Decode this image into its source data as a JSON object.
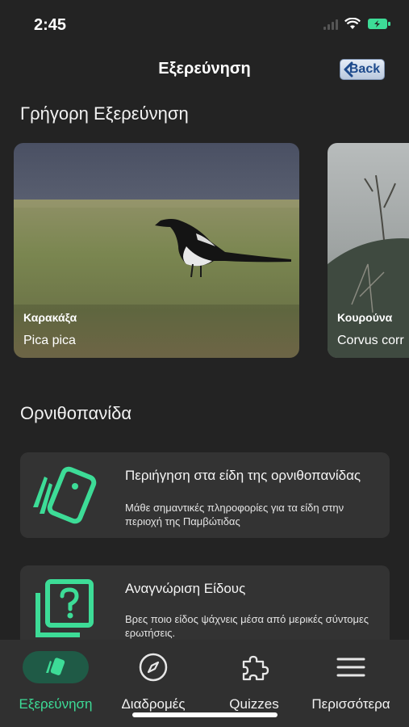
{
  "status": {
    "time": "2:45"
  },
  "nav": {
    "title": "Εξερεύνηση",
    "back_label": "Back"
  },
  "quick": {
    "title": "Γρήγορη Εξερεύνηση",
    "cards": [
      {
        "name": "Καρακάξα",
        "scientific": "Pica pica"
      },
      {
        "name": "Κουρούνα",
        "scientific": "Corvus corr"
      }
    ]
  },
  "guide": {
    "title": "Ορνιθοπανίδα",
    "items": [
      {
        "title": "Περιήγηση στα είδη της ορνιθοπανίδας",
        "description": "Μάθε σημαντικές πληροφορίες για τα είδη στην περιοχή της Παμβώτιδας",
        "icon": "cards-icon"
      },
      {
        "title": "Αναγνώριση Είδους",
        "description": "Βρες ποιο είδος ψάχνεις μέσα από μερικές σύντομες ερωτήσεις.",
        "icon": "question-icon"
      }
    ]
  },
  "tabs": [
    {
      "label": "Εξερεύνηση",
      "icon": "cards-icon",
      "active": true
    },
    {
      "label": "Διαδρομές",
      "icon": "compass-icon",
      "active": false
    },
    {
      "label": "Quizzes",
      "icon": "puzzle-icon",
      "active": false
    },
    {
      "label": "Περισσότερα",
      "icon": "menu-icon",
      "active": false
    }
  ],
  "colors": {
    "accent": "#3ddc97",
    "background": "#232323",
    "card": "#333333",
    "tab_bar": "#303030"
  }
}
